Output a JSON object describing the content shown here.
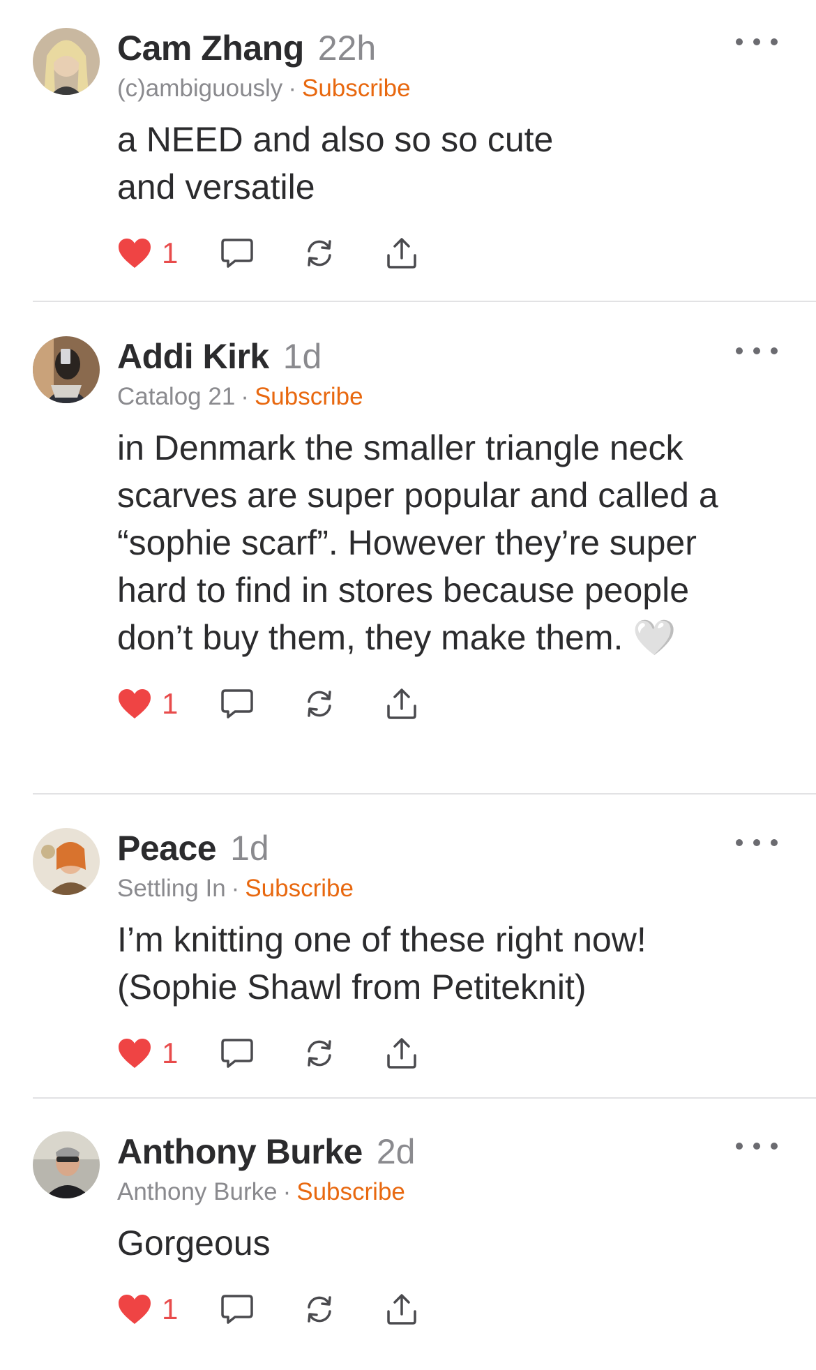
{
  "comments": [
    {
      "name": "Cam Zhang",
      "time": "22h",
      "publication": "(c)ambiguously",
      "separator": "·",
      "subscribe": "Subscribe",
      "text": "a NEED and also so so cute and versatile",
      "likes": "1"
    },
    {
      "name": "Addi Kirk",
      "time": "1d",
      "publication": "Catalog 21",
      "separator": "·",
      "subscribe": "Subscribe",
      "text": "in Denmark the smaller triangle neck scarves are super popular and called a “sophie scarf”. However they’re super hard to find in stores because people don’t buy them, they make them. 🤍",
      "likes": "1"
    },
    {
      "name": "Peace",
      "time": "1d",
      "publication": "Settling In",
      "separator": "·",
      "subscribe": "Subscribe",
      "text": "I’m knitting one of these right now! (Sophie Shawl from Petiteknit)",
      "likes": "1"
    },
    {
      "name": "Anthony Burke",
      "time": "2d",
      "publication": "Anthony Burke",
      "separator": "·",
      "subscribe": "Subscribe",
      "text": "Gorgeous",
      "likes": "1"
    }
  ],
  "colors": {
    "accent": "#e8680f",
    "like": "#ef4444",
    "text": "#2b2b2d",
    "muted": "#8a8a8e",
    "divider": "#e2e2e4"
  },
  "icons": [
    "heart-icon",
    "comment-icon",
    "restack-icon",
    "share-icon",
    "more-icon"
  ]
}
